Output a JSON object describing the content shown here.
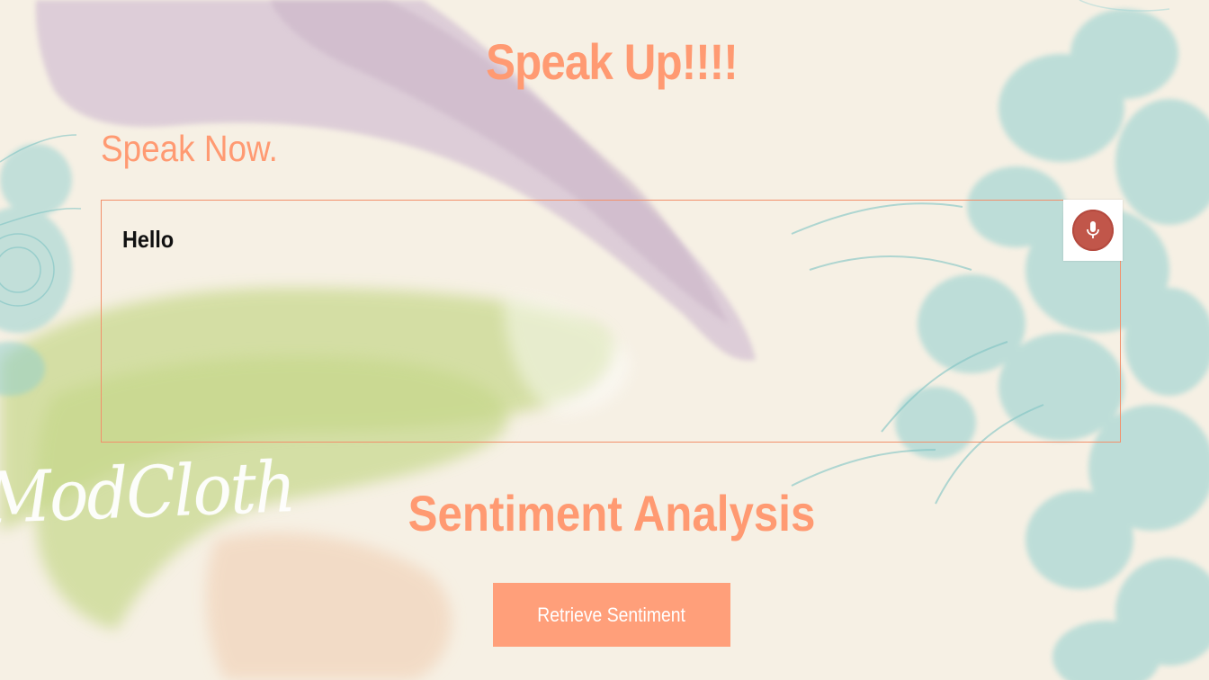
{
  "header": {
    "title": "Speak Up!!!!"
  },
  "speech": {
    "prompt": "Speak Now.",
    "transcript": "Hello",
    "mic_icon": "microphone-icon"
  },
  "sentiment": {
    "title": "Sentiment Analysis",
    "button_label": "Retrieve Sentiment"
  },
  "brand": {
    "logo_text": "ModCloth"
  },
  "colors": {
    "accent": "#ff9a72",
    "mic": "#c1564a",
    "button_text": "#ffffff"
  }
}
